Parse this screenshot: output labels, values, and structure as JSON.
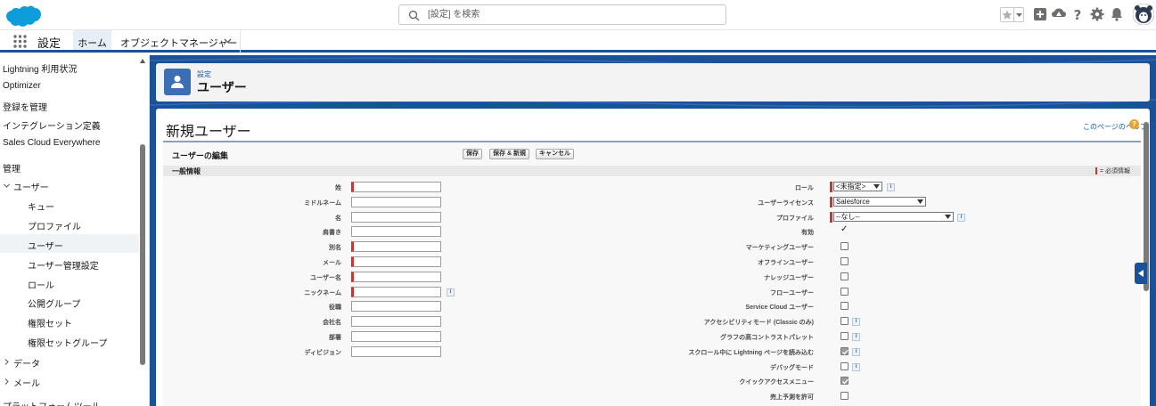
{
  "header": {
    "search_placeholder": "[設定] を検索"
  },
  "nav": {
    "app_name": "設定",
    "tabs": [
      {
        "label": "ホーム"
      },
      {
        "label": "オブジェクトマネージャー"
      }
    ]
  },
  "sidebar": {
    "items": [
      {
        "label": "Lightning 利用状況"
      },
      {
        "label": "Optimizer"
      },
      {
        "label": "登録を管理"
      },
      {
        "label": "インテグレーション定義"
      },
      {
        "label": "Sales Cloud Everywhere"
      },
      {
        "label": "管理"
      },
      {
        "label": "ユーザー"
      },
      {
        "label": "キュー"
      },
      {
        "label": "プロファイル"
      },
      {
        "label": "ユーザー"
      },
      {
        "label": "ユーザー管理設定"
      },
      {
        "label": "ロール"
      },
      {
        "label": "公開グループ"
      },
      {
        "label": "権限セット"
      },
      {
        "label": "権限セットグループ"
      },
      {
        "label": "データ"
      },
      {
        "label": "メール"
      },
      {
        "label": "プラットフォームツール"
      }
    ]
  },
  "page_header": {
    "breadcrumb": "設定",
    "title": "ユーザー"
  },
  "content": {
    "title": "新規ユーザー",
    "help_link": "このページのヘルプ",
    "block_title": "ユーザーの編集",
    "buttons": {
      "save": "保存",
      "save_new": "保存 & 新規",
      "cancel": "キャンセル"
    },
    "section_title": "一般情報",
    "required_legend": "= 必須情報",
    "left_fields": [
      {
        "label": "姓"
      },
      {
        "label": "ミドルネーム"
      },
      {
        "label": "名"
      },
      {
        "label": "肩書き"
      },
      {
        "label": "別名"
      },
      {
        "label": "メール"
      },
      {
        "label": "ユーザー名"
      },
      {
        "label": "ニックネーム"
      },
      {
        "label": "役職"
      },
      {
        "label": "会社名"
      },
      {
        "label": "部署"
      },
      {
        "label": "ディビジョン"
      }
    ],
    "right_fields": [
      {
        "label": "ロール",
        "value": "<未指定>"
      },
      {
        "label": "ユーザーライセンス",
        "value": "Salesforce"
      },
      {
        "label": "プロファイル",
        "value": "--なし--"
      },
      {
        "label": "有効",
        "value": "✓"
      },
      {
        "label": "マーケティングユーザー"
      },
      {
        "label": "オフラインユーザー"
      },
      {
        "label": "ナレッジユーザー"
      },
      {
        "label": "フローユーザー"
      },
      {
        "label": "Service Cloud ユーザー"
      },
      {
        "label": "アクセシビリティモード (Classic のみ)"
      },
      {
        "label": "グラフの高コントラストパレット"
      },
      {
        "label": "スクロール中に Lightning ページを読み込む"
      },
      {
        "label": "デバッグモード"
      },
      {
        "label": "クイックアクセスメニュー"
      },
      {
        "label": "売上予測を許可"
      }
    ],
    "info_icon_glyph": "i",
    "help_icon_glyph": "?"
  }
}
